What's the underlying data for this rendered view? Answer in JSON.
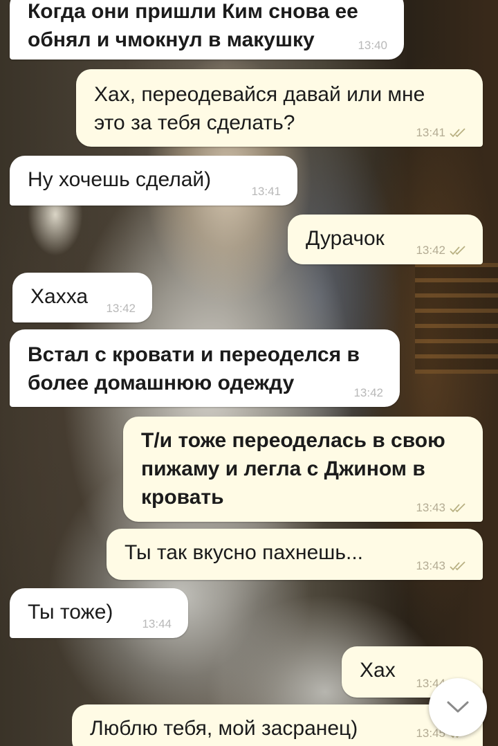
{
  "messages": [
    {
      "dir": "in",
      "bold": true,
      "text": "Когда они пришли Ким снова ее\nобнял и чмокнул в макушку",
      "time": "13:40",
      "read": false
    },
    {
      "dir": "out",
      "bold": false,
      "text": "Хах, переодевайся давай или мне\nэто за тебя сделать?",
      "time": "13:41",
      "read": true
    },
    {
      "dir": "in",
      "bold": false,
      "text": "Ну хочешь сделай)",
      "time": "13:41",
      "read": false
    },
    {
      "dir": "out",
      "bold": false,
      "text": "Дурачок",
      "time": "13:42",
      "read": true
    },
    {
      "dir": "in",
      "bold": false,
      "text": "Хахха",
      "time": "13:42",
      "read": false
    },
    {
      "dir": "in",
      "bold": true,
      "text": "Встал с кровати и переоделся в\nболее домашнюю одежду",
      "time": "13:42",
      "read": false
    },
    {
      "dir": "out",
      "bold": true,
      "text": "Т/и тоже переоделась в свою\nпижаму и легла с Джином в\nкровать",
      "time": "13:43",
      "read": true
    },
    {
      "dir": "out",
      "bold": false,
      "text": "Ты так вкусно пахнешь...",
      "time": "13:43",
      "read": true
    },
    {
      "dir": "in",
      "bold": false,
      "text": "Ты тоже)",
      "time": "13:44",
      "read": false
    },
    {
      "dir": "out",
      "bold": false,
      "text": "Хах",
      "time": "13:44",
      "read": true
    },
    {
      "dir": "out",
      "bold": false,
      "text": "Люблю тебя, мой засранец)",
      "time": "13:45",
      "read": true
    }
  ],
  "scroll_button": {
    "icon": "chevron-down-icon"
  },
  "colors": {
    "incoming_bubble": "#ffffff",
    "outgoing_bubble": "#fffbe5",
    "read_ticks": "#b8b082"
  }
}
